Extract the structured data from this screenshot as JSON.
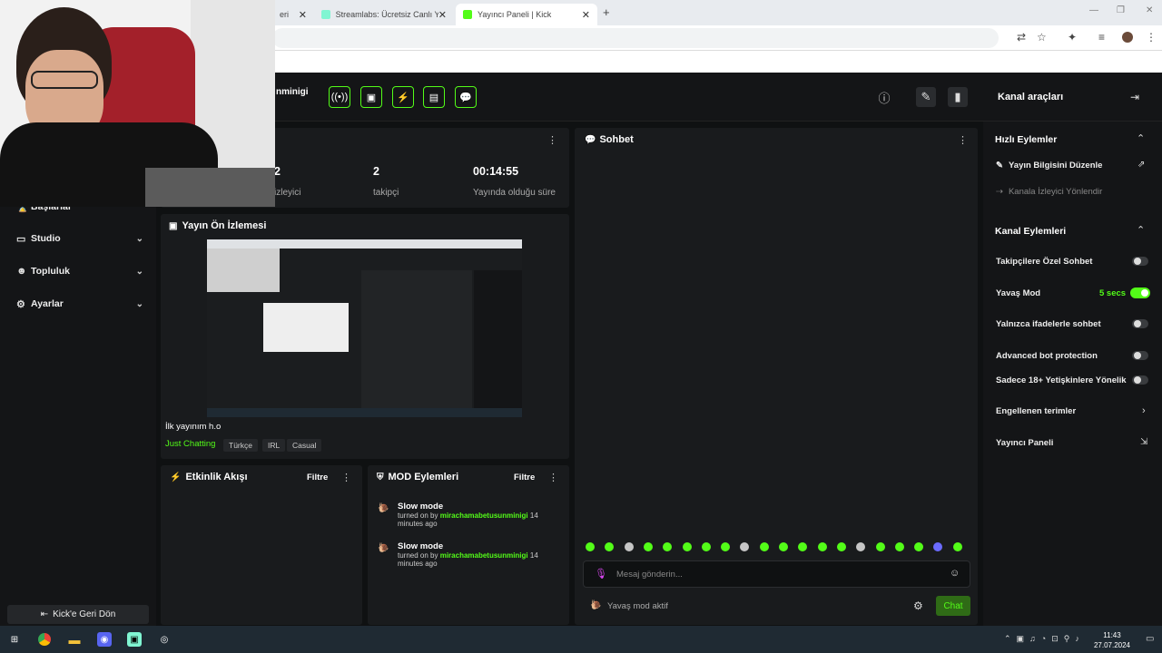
{
  "browser": {
    "tabs": [
      {
        "label": "eri"
      },
      {
        "label": "Streamlabs: Ücretsiz Canlı Yayın"
      },
      {
        "label": "Yayıncı Paneli | Kick"
      }
    ],
    "new_tab": "+"
  },
  "header": {
    "channel_name": "nminigi",
    "right_title": "Kanal araçları"
  },
  "sidebar": {
    "items": [
      {
        "label": "Başlarlar"
      },
      {
        "label": "Studio"
      },
      {
        "label": "Topluluk"
      },
      {
        "label": "Ayarlar"
      }
    ],
    "back_button": "Kick'e Geri Dön"
  },
  "stats": {
    "viewers_value": "2",
    "viewers_label": "izleyici",
    "followers_value": "2",
    "followers_label": "takipçi",
    "uptime_value": "00:14:55",
    "uptime_label": "Yayında olduğu süre"
  },
  "preview": {
    "title": "Yayın Ön İzlemesi",
    "stream_title": "İlk yayınım h.o",
    "category": "Just Chatting",
    "tags": [
      "Türkçe",
      "IRL",
      "Casual"
    ]
  },
  "activity": {
    "title": "Etkinlik Akışı",
    "filter": "Filtre"
  },
  "mod_actions": {
    "title": "MOD Eylemleri",
    "filter": "Filtre",
    "entries": [
      {
        "title": "Slow mode",
        "prefix": "turned on by",
        "user": "mirachamabetusunminigi",
        "age": "14 minutes ago"
      },
      {
        "title": "Slow mode",
        "prefix": "turned on by",
        "user": "mirachamabetusunminigi",
        "age": "14 minutes ago"
      }
    ]
  },
  "chat": {
    "title": "Sohbet",
    "placeholder": "Mesaj gönderin...",
    "slow_mode_status": "Yavaş mod aktif",
    "send_button": "Chat"
  },
  "quick_actions": {
    "title": "Hızlı Eylemler",
    "items": [
      {
        "label": "Yayın Bilgisini Düzenle"
      },
      {
        "label": "Kanala İzleyici Yönlendir"
      }
    ]
  },
  "channel_actions": {
    "title": "Kanal Eylemleri",
    "items": [
      {
        "label": "Takipçilere Özel Sohbet",
        "on": false
      },
      {
        "label": "Yavaş Mod",
        "value": "5 secs",
        "on": true
      },
      {
        "label": "Yalnızca ifadelerle sohbet",
        "on": false
      },
      {
        "label": "Advanced bot protection",
        "on": false
      },
      {
        "label": "Sadece 18+ Yetişkinlere Yönelik",
        "on": false
      }
    ],
    "links": [
      {
        "label": "Engellenen terimler"
      },
      {
        "label": "Yayıncı Paneli"
      }
    ]
  },
  "taskbar": {
    "time": "11:43",
    "date": "27.07.2024"
  },
  "colors": {
    "accent": "#53fc18",
    "panel": "#191b1d",
    "background": "#0f1112"
  }
}
